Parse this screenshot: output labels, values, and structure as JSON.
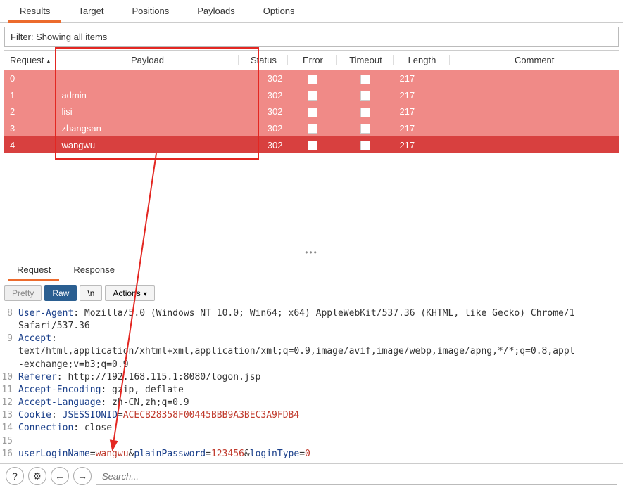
{
  "top_tabs": [
    "Results",
    "Target",
    "Positions",
    "Payloads",
    "Options"
  ],
  "active_top_tab": "Results",
  "filter_text": "Filter: Showing all items",
  "columns": {
    "request": "Request",
    "payload": "Payload",
    "status": "Status",
    "error": "Error",
    "timeout": "Timeout",
    "length": "Length",
    "comment": "Comment"
  },
  "rows": [
    {
      "request": "0",
      "payload": "",
      "status": "302",
      "length": "217"
    },
    {
      "request": "1",
      "payload": "admin",
      "status": "302",
      "length": "217"
    },
    {
      "request": "2",
      "payload": "lisi",
      "status": "302",
      "length": "217"
    },
    {
      "request": "3",
      "payload": "zhangsan",
      "status": "302",
      "length": "217"
    },
    {
      "request": "4",
      "payload": "wangwu",
      "status": "302",
      "length": "217"
    }
  ],
  "sub_tabs": {
    "request": "Request",
    "response": "Response"
  },
  "active_sub_tab": "Request",
  "view_buttons": {
    "pretty": "Pretty",
    "raw": "Raw",
    "newline": "\\n",
    "actions": "Actions"
  },
  "editor_lines": [
    {
      "n": 8,
      "segments": [
        {
          "t": "hdr-name",
          "v": "User-Agent"
        },
        {
          "t": "plain",
          "v": ": Mozilla/5.0 (Windows NT 10.0; Win64; x64) AppleWebKit/537.36 (KHTML, like Gecko) Chrome/1"
        }
      ]
    },
    {
      "n": "",
      "segments": [
        {
          "t": "plain",
          "v": "Safari/537.36"
        }
      ]
    },
    {
      "n": 9,
      "segments": [
        {
          "t": "hdr-name",
          "v": "Accept"
        },
        {
          "t": "plain",
          "v": ":"
        }
      ]
    },
    {
      "n": "",
      "segments": [
        {
          "t": "plain",
          "v": "text/html,application/xhtml+xml,application/xml;q=0.9,image/avif,image/webp,image/apng,*/*;q=0.8,appl"
        }
      ]
    },
    {
      "n": "",
      "segments": [
        {
          "t": "plain",
          "v": "-exchange;v=b3;q=0.9"
        }
      ]
    },
    {
      "n": 10,
      "segments": [
        {
          "t": "hdr-name",
          "v": "Referer"
        },
        {
          "t": "plain",
          "v": ": http://192.168.115.1:8080/logon.jsp"
        }
      ]
    },
    {
      "n": 11,
      "segments": [
        {
          "t": "hdr-name",
          "v": "Accept-Encoding"
        },
        {
          "t": "plain",
          "v": ": gzip, deflate"
        }
      ]
    },
    {
      "n": 12,
      "segments": [
        {
          "t": "hdr-name",
          "v": "Accept-Language"
        },
        {
          "t": "plain",
          "v": ": zh-CN,zh;q=0.9"
        }
      ]
    },
    {
      "n": 13,
      "segments": [
        {
          "t": "hdr-name",
          "v": "Cookie"
        },
        {
          "t": "plain",
          "v": ": "
        },
        {
          "t": "hdr-name",
          "v": "JSESSIONID"
        },
        {
          "t": "plain",
          "v": "="
        },
        {
          "t": "sess",
          "v": "ACECB28358F00445BBB9A3BEC3A9FDB4"
        }
      ]
    },
    {
      "n": 14,
      "segments": [
        {
          "t": "hdr-name",
          "v": "Connection"
        },
        {
          "t": "plain",
          "v": ": close"
        }
      ]
    },
    {
      "n": 15,
      "segments": []
    },
    {
      "n": 16,
      "segments": [
        {
          "t": "param",
          "v": "userLoginName"
        },
        {
          "t": "plain",
          "v": "="
        },
        {
          "t": "val-red",
          "v": "wangwu"
        },
        {
          "t": "plain",
          "v": "&"
        },
        {
          "t": "param",
          "v": "plainPassword"
        },
        {
          "t": "plain",
          "v": "="
        },
        {
          "t": "val-red",
          "v": "123456"
        },
        {
          "t": "plain",
          "v": "&"
        },
        {
          "t": "param",
          "v": "loginType"
        },
        {
          "t": "plain",
          "v": "="
        },
        {
          "t": "val-red",
          "v": "0"
        }
      ]
    }
  ],
  "search_placeholder": "Search...",
  "chart_data": {
    "type": "table",
    "title": "Intruder Results",
    "columns": [
      "Request",
      "Payload",
      "Status",
      "Error",
      "Timeout",
      "Length",
      "Comment"
    ],
    "rows": [
      [
        "0",
        "",
        "302",
        false,
        false,
        "217",
        ""
      ],
      [
        "1",
        "admin",
        "302",
        false,
        false,
        "217",
        ""
      ],
      [
        "2",
        "lisi",
        "302",
        false,
        false,
        "217",
        ""
      ],
      [
        "3",
        "zhangsan",
        "302",
        false,
        false,
        "217",
        ""
      ],
      [
        "4",
        "wangwu",
        "302",
        false,
        false,
        "217",
        ""
      ]
    ]
  }
}
